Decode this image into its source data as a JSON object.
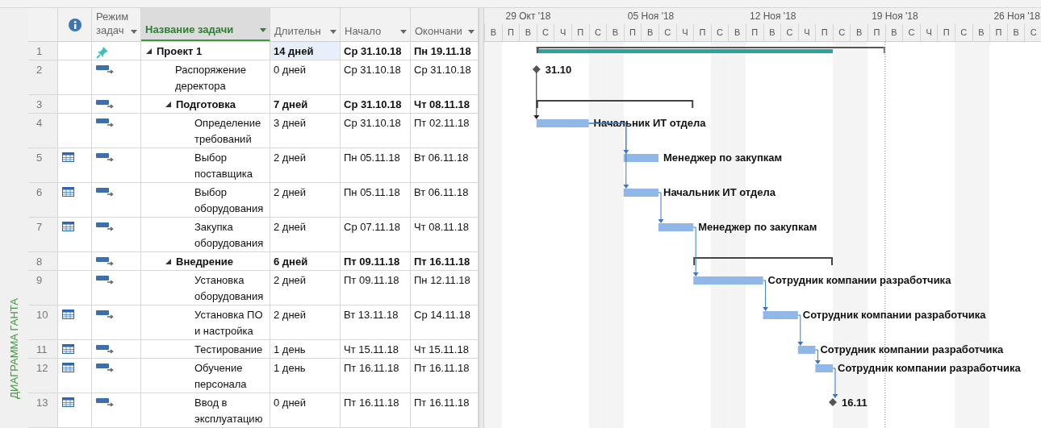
{
  "view_label": "ДИАГРАММА ГАНТА",
  "columns": [
    {
      "selected": false
    },
    {
      "label": "Режим задач",
      "selected": false
    },
    {
      "label": "Название задачи",
      "selected": true
    },
    {
      "label": "Длительн",
      "selected": false
    },
    {
      "label": "Начало",
      "selected": false
    },
    {
      "label": "Окончани",
      "selected": false
    }
  ],
  "timeline": {
    "weeks": [
      "29 Окт '18",
      "05 Ноя '18",
      "12 Ноя '18",
      "19 Ноя '18",
      "26 Ноя '18"
    ],
    "days": [
      {
        "letter": "В",
        "weekend": true
      },
      {
        "letter": "П",
        "weekend": false
      },
      {
        "letter": "В",
        "weekend": false
      },
      {
        "letter": "С",
        "weekend": false
      },
      {
        "letter": "Ч",
        "weekend": false
      },
      {
        "letter": "П",
        "weekend": false
      },
      {
        "letter": "С",
        "weekend": true
      },
      {
        "letter": "В",
        "weekend": true
      },
      {
        "letter": "П",
        "weekend": false
      },
      {
        "letter": "В",
        "weekend": false
      },
      {
        "letter": "С",
        "weekend": false
      },
      {
        "letter": "Ч",
        "weekend": false
      },
      {
        "letter": "П",
        "weekend": false
      },
      {
        "letter": "С",
        "weekend": true
      },
      {
        "letter": "В",
        "weekend": true
      },
      {
        "letter": "П",
        "weekend": false
      },
      {
        "letter": "В",
        "weekend": false
      },
      {
        "letter": "С",
        "weekend": false
      },
      {
        "letter": "Ч",
        "weekend": false
      },
      {
        "letter": "П",
        "weekend": false
      },
      {
        "letter": "С",
        "weekend": true
      },
      {
        "letter": "В",
        "weekend": true
      },
      {
        "letter": "П",
        "weekend": false
      },
      {
        "letter": "В",
        "weekend": false
      },
      {
        "letter": "С",
        "weekend": false
      },
      {
        "letter": "Ч",
        "weekend": false
      },
      {
        "letter": "П",
        "weekend": false
      },
      {
        "letter": "С",
        "weekend": true
      },
      {
        "letter": "В",
        "weekend": true
      },
      {
        "letter": "П",
        "weekend": false
      },
      {
        "letter": "В",
        "weekend": false
      },
      {
        "letter": "С",
        "weekend": false
      }
    ]
  },
  "tasks": [
    {
      "n": "1",
      "name": "Проект 1",
      "duration": "14 дней",
      "start": "Ср 31.10.18",
      "finish": "Пн 19.11.18",
      "kind": "project",
      "manual": true,
      "calendar": false,
      "expanded": true,
      "selected": true,
      "linked": false,
      "children": [
        {
          "n": "2",
          "name": "Распоряжение деректора",
          "duration": "0 дней",
          "start": "Ср 31.10.18",
          "finish": "Ср 31.10.18",
          "kind": "milestone",
          "manual": false,
          "calendar": false,
          "selected": false,
          "linked": false,
          "label": "31.10"
        },
        {
          "n": "3",
          "name": "Подготовка",
          "duration": "7 дней",
          "start": "Ср 31.10.18",
          "finish": "Чт 08.11.18",
          "kind": "summary",
          "manual": false,
          "calendar": false,
          "expanded": true,
          "selected": false,
          "linked": false,
          "children": [
            {
              "n": "4",
              "name": "Определение требований",
              "duration": "3 дней",
              "start": "Ср 31.10.18",
              "finish": "Пт 02.11.18",
              "kind": "task",
              "manual": false,
              "calendar": false,
              "selected": false,
              "linked": true,
              "resource": "Начальник ИТ отдела"
            },
            {
              "n": "5",
              "name": "Выбор поставщика",
              "duration": "2 дней",
              "start": "Пн 05.11.18",
              "finish": "Вт 06.11.18",
              "kind": "task",
              "manual": false,
              "calendar": true,
              "selected": false,
              "linked": true,
              "resource": "Менеджер по закупкам"
            },
            {
              "n": "6",
              "name": "Выбор оборудования",
              "duration": "2 дней",
              "start": "Пн 05.11.18",
              "finish": "Вт 06.11.18",
              "kind": "task",
              "manual": false,
              "calendar": true,
              "selected": false,
              "linked": true,
              "resource": "Начальник ИТ отдела"
            },
            {
              "n": "7",
              "name": "Закупка оборудования",
              "duration": "2 дней",
              "start": "Ср 07.11.18",
              "finish": "Чт 08.11.18",
              "kind": "task",
              "manual": false,
              "calendar": true,
              "selected": false,
              "linked": true,
              "resource": "Менеджер по закупкам"
            }
          ]
        },
        {
          "n": "8",
          "name": "Внедрение",
          "duration": "6 дней",
          "start": "Пт 09.11.18",
          "finish": "Пт 16.11.18",
          "kind": "summary",
          "manual": false,
          "calendar": false,
          "expanded": true,
          "selected": false,
          "linked": false,
          "children": [
            {
              "n": "9",
              "name": "Установка оборудования",
              "duration": "2 дней",
              "start": "Пт 09.11.18",
              "finish": "Пн 12.11.18",
              "kind": "task",
              "manual": false,
              "calendar": false,
              "selected": false,
              "linked": true,
              "resource": "Сотрудник компании разработчика"
            },
            {
              "n": "10",
              "name": "Установка ПО и настройка",
              "duration": "2 дней",
              "start": "Вт 13.11.18",
              "finish": "Ср 14.11.18",
              "kind": "task",
              "manual": false,
              "calendar": true,
              "selected": false,
              "linked": true,
              "resource": "Сотрудник компании разработчика"
            },
            {
              "n": "11",
              "name": "Тестирование",
              "duration": "1 день",
              "start": "Чт 15.11.18",
              "finish": "Чт 15.11.18",
              "kind": "task",
              "manual": false,
              "calendar": true,
              "selected": false,
              "linked": true,
              "resource": "Сотрудник компании разработчика"
            },
            {
              "n": "12",
              "name": "Обучение персонала",
              "duration": "1 день",
              "start": "Пт 16.11.18",
              "finish": "Пт 16.11.18",
              "kind": "task",
              "manual": false,
              "calendar": true,
              "selected": false,
              "linked": true,
              "resource": "Сотрудник компании разработчика"
            },
            {
              "n": "13",
              "name": "Ввод в эксплуатацию",
              "duration": "0 дней",
              "start": "Пт 16.11.18",
              "finish": "Пт 16.11.18",
              "kind": "milestone",
              "manual": false,
              "calendar": true,
              "selected": false,
              "linked": true,
              "label": "16.11"
            }
          ]
        }
      ]
    }
  ]
}
